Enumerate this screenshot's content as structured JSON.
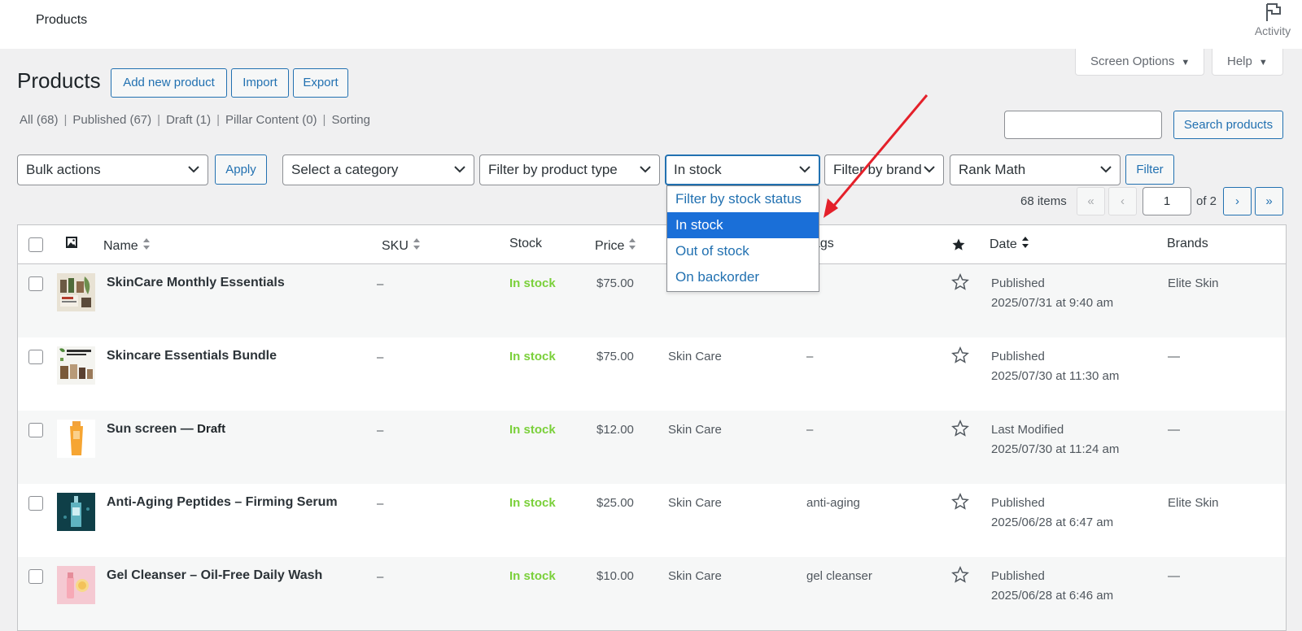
{
  "topbar": {
    "title": "Products",
    "activity_label": "Activity"
  },
  "header_tabs": {
    "screen_options": "Screen Options",
    "help": "Help"
  },
  "page": {
    "title": "Products",
    "add_new": "Add new product",
    "import": "Import",
    "export": "Export"
  },
  "views": [
    {
      "label": "All (68)"
    },
    {
      "label": "Published (67)"
    },
    {
      "label": "Draft (1)"
    },
    {
      "label": "Pillar Content (0)"
    },
    {
      "label": "Sorting"
    }
  ],
  "search": {
    "value": "",
    "button": "Search products"
  },
  "filters": {
    "bulk_actions": "Bulk actions",
    "apply": "Apply",
    "category": "Select a category",
    "product_type": "Filter by product type",
    "stock_status": "In stock",
    "brand": "Filter by brand",
    "rank_math": "Rank Math",
    "filter_button": "Filter"
  },
  "stock_dropdown": {
    "options": [
      "Filter by stock status",
      "In stock",
      "Out of stock",
      "On backorder"
    ],
    "selected_index": 1
  },
  "pagination": {
    "items": "68 items",
    "first": "«",
    "prev": "‹",
    "current": "1",
    "of": "of 2",
    "next": "›",
    "last": "»"
  },
  "columns": {
    "name": "Name",
    "sku": "SKU",
    "stock": "Stock",
    "price": "Price",
    "tags": "Tags",
    "date": "Date",
    "brands": "Brands"
  },
  "rows": [
    {
      "name": "SkinCare Monthly Essentials",
      "draft": "",
      "sku": "–",
      "stock": "In stock",
      "price": "$75.00",
      "categories": "",
      "tags": "",
      "date_status": "Published",
      "date": "2025/07/31 at 9:40 am",
      "brand": "Elite Skin"
    },
    {
      "name": "Skincare Essentials Bundle",
      "draft": "",
      "sku": "–",
      "stock": "In stock",
      "price": "$75.00",
      "categories": "Skin Care",
      "tags": "–",
      "date_status": "Published",
      "date": "2025/07/30 at 11:30 am",
      "brand": "—"
    },
    {
      "name": "Sun screen — ",
      "draft": "Draft",
      "sku": "–",
      "stock": "In stock",
      "price": "$12.00",
      "categories": "Skin Care",
      "tags": "–",
      "date_status": "Last Modified",
      "date": "2025/07/30 at 11:24 am",
      "brand": "—"
    },
    {
      "name": "Anti-Aging Peptides – Firming Serum",
      "draft": "",
      "sku": "–",
      "stock": "In stock",
      "price": "$25.00",
      "categories": "Skin Care",
      "tags": "anti-aging",
      "date_status": "Published",
      "date": "2025/06/28 at 6:47 am",
      "brand": "Elite Skin"
    },
    {
      "name": "Gel Cleanser – Oil-Free Daily Wash",
      "draft": "",
      "sku": "–",
      "stock": "In stock",
      "price": "$10.00",
      "categories": "Skin Care",
      "tags": "gel cleanser",
      "date_status": "Published",
      "date": "2025/06/28 at 6:46 am",
      "brand": "—"
    }
  ],
  "colors": {
    "accent": "#2271b1",
    "in_stock": "#7ad03a",
    "annotation_arrow": "#e4202a",
    "dropdown_highlight": "#1a6fd8"
  }
}
